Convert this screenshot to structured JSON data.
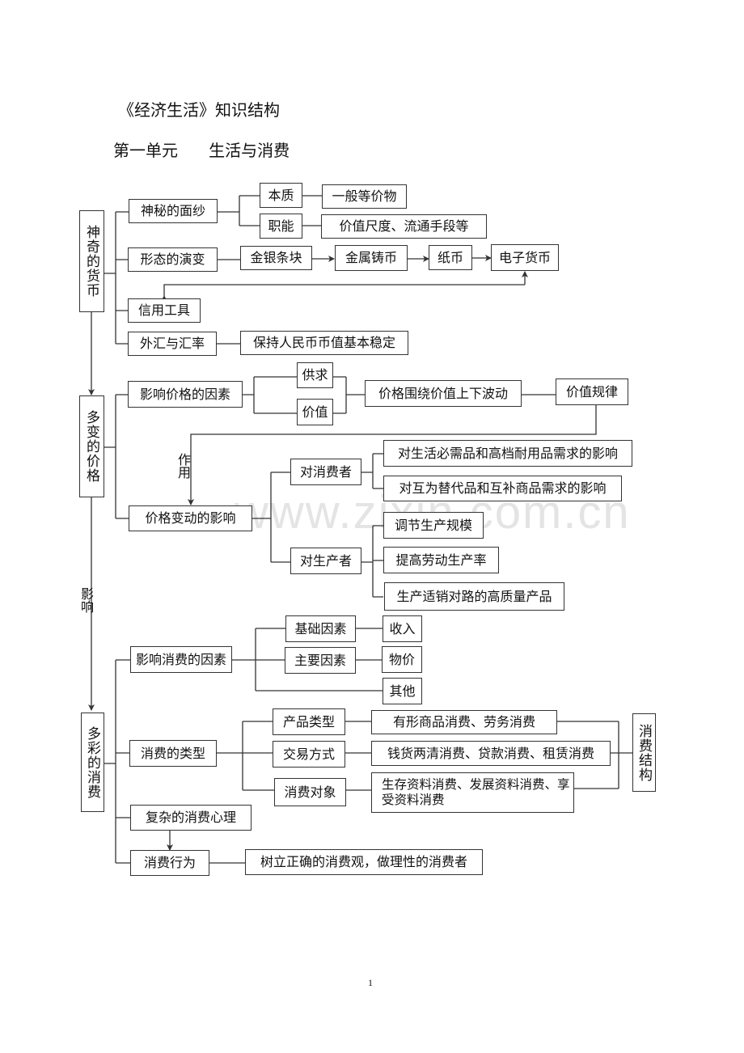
{
  "header": {
    "title": "《经济生活》知识结构",
    "unit": "第一单元      生活与消费"
  },
  "watermark": "www.zixin.com.cn",
  "money": {
    "root": "神奇的货币",
    "veil": "神秘的面纱",
    "essence": "本质",
    "essence_value": "一般等价物",
    "functions": "职能",
    "functions_value": "价值尺度、流通手段等",
    "forms": "形态的演变",
    "form_steps": [
      "金银条块",
      "金属铸币",
      "纸币",
      "电子货币"
    ],
    "credit": "信用工具",
    "forex": "外汇与汇率",
    "forex_value": "保持人民币币值基本稳定"
  },
  "price": {
    "root": "多变的价格",
    "factors": "影响价格的因素",
    "supply_demand": "供求",
    "value": "价值",
    "fluctuation": "价格围绕价值上下波动",
    "law_of_value": "价值规律",
    "effect_label": "作用",
    "impact": "价格变动的影响",
    "on_consumers": "对消费者",
    "consumer_items": [
      "对生活必需品和高档耐用品需求的影响",
      "对互为替代品和互补商品需求的影响"
    ],
    "on_producers": "对生产者",
    "producer_items": [
      "调节生产规模",
      "提高劳动生产率",
      "生产适销对路的高质量产品"
    ]
  },
  "influence_label": "影响",
  "consumption": {
    "root": "多彩的消费",
    "factors": "影响消费的因素",
    "basic": "基础因素",
    "basic_value": "收入",
    "main": "主要因素",
    "main_value": "物价",
    "other": "其他",
    "types": "消费的类型",
    "product_type": "产品类型",
    "product_type_value": "有形商品消费、劳务消费",
    "transaction": "交易方式",
    "transaction_value": "钱货两清消费、贷款消费、租赁消费",
    "object": "消费对象",
    "object_value": "生存资料消费、发展资料消费、享受资料消费",
    "structure": "消费结构",
    "psychology": "复杂的消费心理",
    "behavior": "消费行为",
    "behavior_value": "树立正确的消费观，做理性的消费者"
  },
  "page_number": "1"
}
